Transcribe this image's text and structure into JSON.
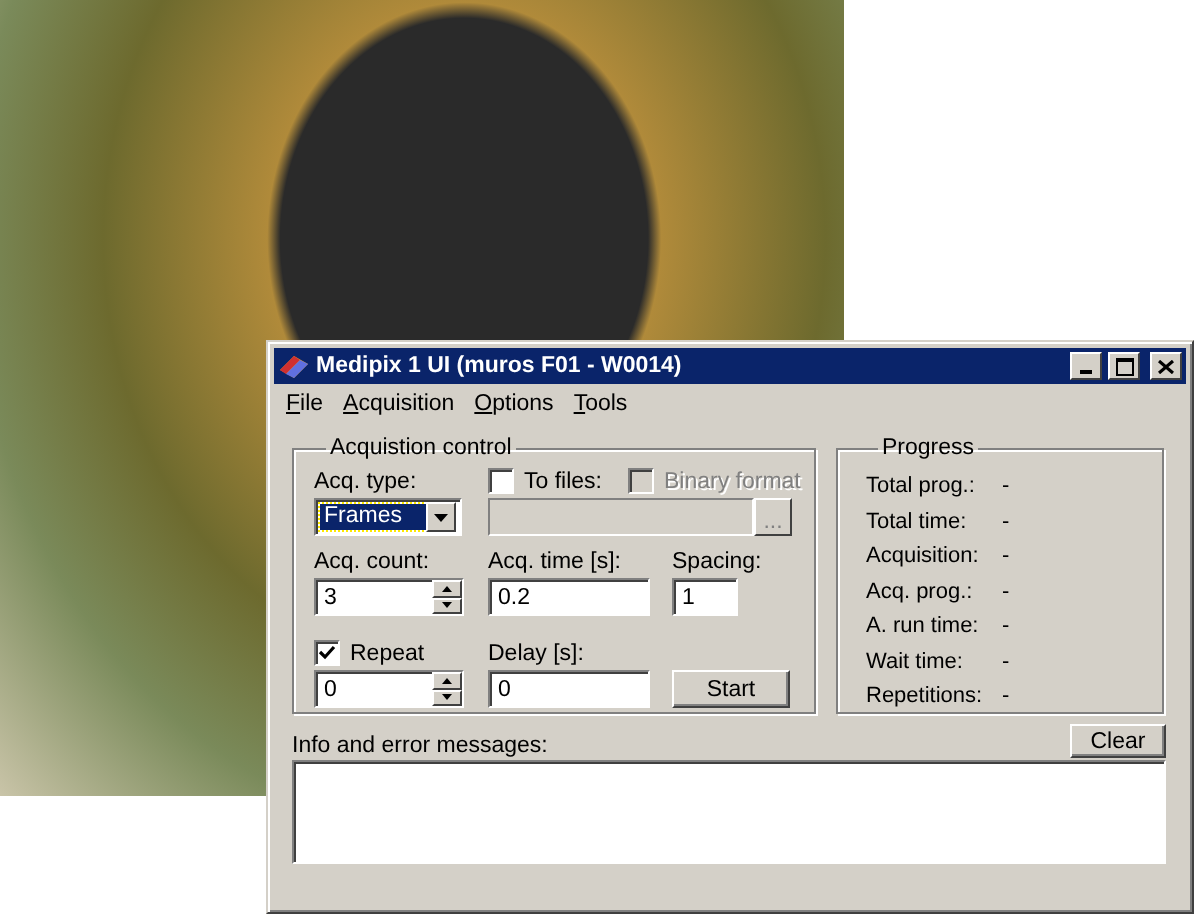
{
  "window": {
    "title": "Medipix 1 UI (muros F01 - W0014)"
  },
  "menu": [
    {
      "label": "File"
    },
    {
      "label": "Acquisition"
    },
    {
      "label": "Options"
    },
    {
      "label": "Tools"
    }
  ],
  "acquisition_control": {
    "title": "Acquistion control",
    "acq_type": {
      "label": "Acq. type:",
      "value": "Frames",
      "focused": true
    },
    "to_files": {
      "label": "To files:",
      "checked": false,
      "disabled": false
    },
    "binary_format": {
      "label": "Binary format",
      "checked": false,
      "disabled": true
    },
    "file_path": {
      "disabled": true,
      "browse_label": "..."
    },
    "acq_count": {
      "label": "Acq. count:",
      "value": "3"
    },
    "acq_time": {
      "label": "Acq. time [s]:",
      "value": "0.2"
    },
    "spacing": {
      "label": "Spacing:",
      "value": "1"
    },
    "repeat": {
      "label": "Repeat",
      "checked": true,
      "disabled": false
    },
    "repetitions": {
      "value": "0"
    },
    "delay": {
      "label": "Delay [s]:",
      "value": "0"
    },
    "start_button": "Start"
  },
  "progress": {
    "title": "Progress",
    "rows": [
      {
        "label": "Total prog.:",
        "value": "-"
      },
      {
        "label": "Total time:",
        "value": "-"
      },
      {
        "label": "Acquisition:",
        "value": "-"
      },
      {
        "label": "Acq. prog.:",
        "value": "-"
      },
      {
        "label": "A. run time:",
        "value": "-"
      },
      {
        "label": "Wait time:",
        "value": "-"
      },
      {
        "label": "Repetitions:",
        "value": "-"
      }
    ]
  },
  "messages": {
    "label": "Info and error messages:",
    "clear_button": "Clear"
  }
}
